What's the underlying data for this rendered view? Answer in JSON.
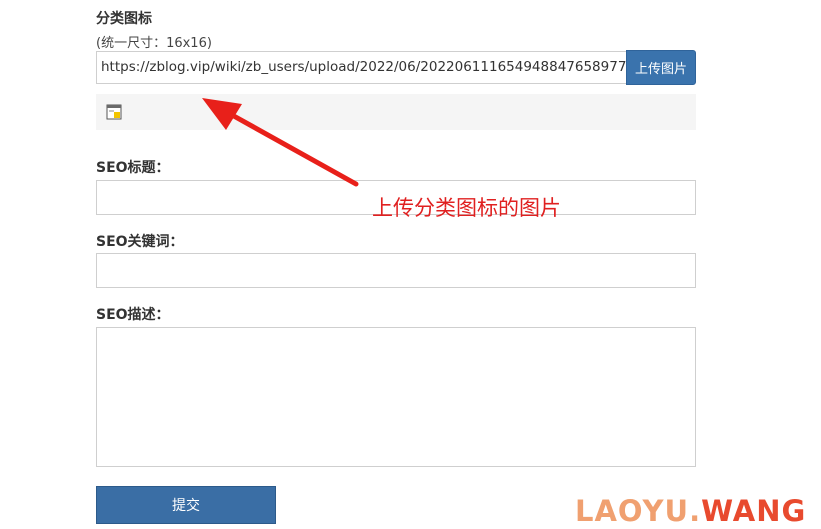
{
  "form": {
    "category_icon_label": "分类图标",
    "category_icon_hint": "(统一尺寸：16x16)",
    "icon_url_value": "https://zblog.vip/wiki/zb_users/upload/2022/06/202206111654948847658977",
    "upload_button_label": "上传图片",
    "seo_title_label": "SEO标题：",
    "seo_title_value": "",
    "seo_keywords_label": "SEO关键词：",
    "seo_keywords_value": "",
    "seo_description_label": "SEO描述：",
    "seo_description_value": "",
    "submit_label": "提交"
  },
  "annotation": {
    "text": "上传分类图标的图片",
    "color": "#e02020"
  },
  "watermark": {
    "part1": "LAOYU.",
    "part2": "WANG"
  },
  "colors": {
    "primary_button": "#3a73ad",
    "annotation_red": "#e02020"
  },
  "icons": {
    "preview": "image-preview-icon",
    "arrow": "red-arrow-annotation"
  }
}
